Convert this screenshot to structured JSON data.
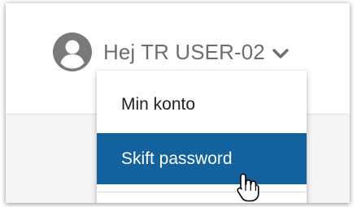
{
  "colors": {
    "accent": "#14629d",
    "greeting_text": "#6d6d6d",
    "avatar": "#7a7a7a",
    "menu_text": "#222222",
    "highlight_text": "#ffffff"
  },
  "header": {
    "greeting": "Hej TR USER-02",
    "avatar_icon": "user-circle-icon",
    "chevron_icon": "chevron-down-icon"
  },
  "dropdown": {
    "items": [
      {
        "label": "Min konto"
      },
      {
        "label": "Skift password",
        "state": "hover"
      }
    ]
  },
  "cursor": {
    "type": "hand-pointer-icon"
  }
}
